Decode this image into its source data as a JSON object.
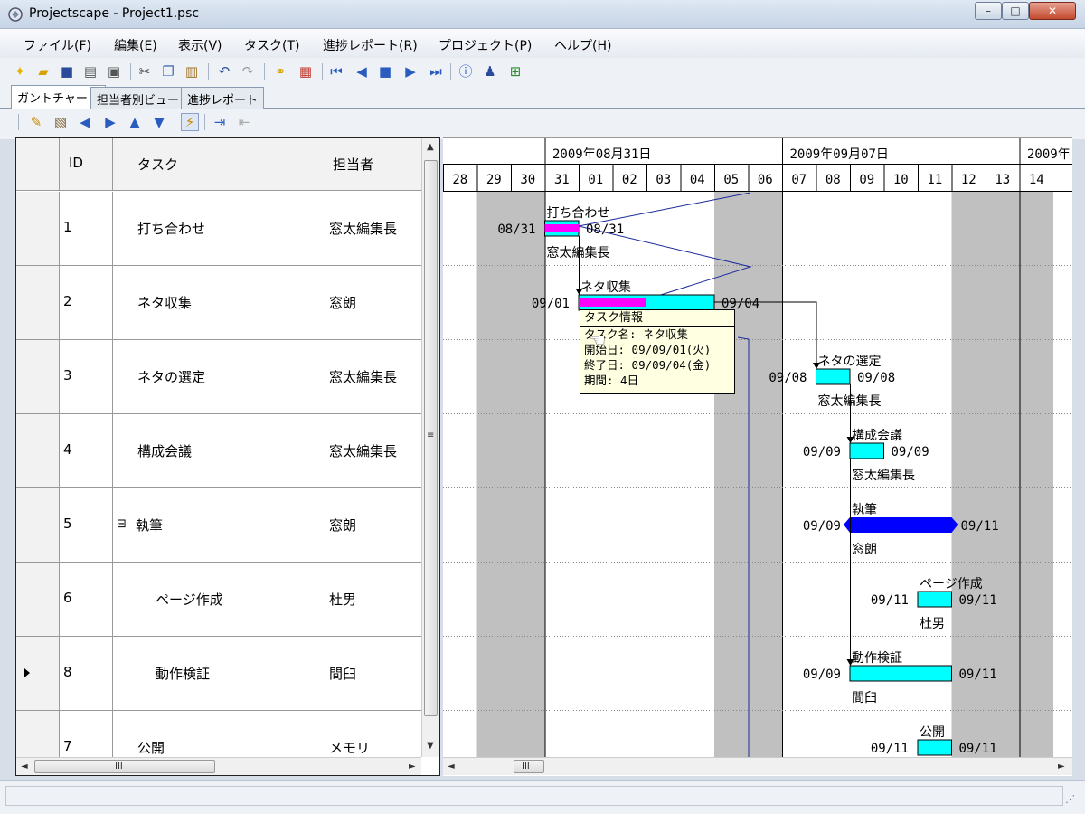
{
  "window": {
    "title": "Projectscape - Project1.psc",
    "controls": {
      "minimize": "–",
      "maximize": "□",
      "close": "✕"
    }
  },
  "menu": [
    "ファイル(F)",
    "編集(E)",
    "表示(V)",
    "タスク(T)",
    "進捗レポート(R)",
    "プロジェクト(P)",
    "ヘルプ(H)"
  ],
  "toolbar_icons": [
    "new-file-icon",
    "open-folder-icon",
    "save-icon",
    "print-icon",
    "print-preview-icon",
    "cut-icon",
    "copy-icon",
    "paste-icon",
    "undo-icon",
    "redo-icon",
    "link-icon",
    "calendar-icon",
    "first-icon",
    "prev-icon",
    "stop-icon",
    "next-icon",
    "last-icon",
    "info-icon",
    "users-icon",
    "add-task-icon"
  ],
  "tabs": [
    "ガントチャート",
    "担当者別ビュー",
    "進捗レポート"
  ],
  "grid": {
    "headers": {
      "id": "ID",
      "task": "タスク",
      "assignee": "担当者"
    },
    "rows": [
      {
        "id": "1",
        "task": "打ち合わせ",
        "assignee": "窓太編集長",
        "indent": 0,
        "collapse": "",
        "current": false
      },
      {
        "id": "2",
        "task": "ネタ収集",
        "assignee": "窓朗",
        "indent": 0,
        "collapse": "",
        "current": false
      },
      {
        "id": "3",
        "task": "ネタの選定",
        "assignee": "窓太編集長",
        "indent": 0,
        "collapse": "",
        "current": false
      },
      {
        "id": "4",
        "task": "構成会議",
        "assignee": "窓太編集長",
        "indent": 0,
        "collapse": "",
        "current": false
      },
      {
        "id": "5",
        "task": "執筆",
        "assignee": "窓朗",
        "indent": 0,
        "collapse": "⊟",
        "current": false
      },
      {
        "id": "6",
        "task": "ページ作成",
        "assignee": "杜男",
        "indent": 1,
        "collapse": "",
        "current": false
      },
      {
        "id": "8",
        "task": "動作検証",
        "assignee": "間臼",
        "indent": 1,
        "collapse": "",
        "current": true
      },
      {
        "id": "7",
        "task": "公開",
        "assignee": "メモリ",
        "indent": 0,
        "collapse": "",
        "current": false
      }
    ],
    "scroll_marks": {
      "left": "◄",
      "right": "►",
      "up": "▲",
      "down": "▼",
      "grip": "III",
      "vgrip": "≡"
    }
  },
  "gantt": {
    "weeks": [
      "2009年08月31日",
      "2009年09月07日",
      "2009年"
    ],
    "days": [
      "28",
      "29",
      "30",
      "31",
      "01",
      "02",
      "03",
      "04",
      "05",
      "06",
      "07",
      "08",
      "09",
      "10",
      "11",
      "12",
      "13",
      "14"
    ],
    "weekend_days": [
      "29",
      "30",
      "05",
      "06",
      "12",
      "13",
      "14"
    ],
    "tasks": [
      {
        "name": "打ち合わせ",
        "start": "08/31",
        "end": "08/31",
        "assignee": "窓太編集長",
        "progress": 1.0,
        "type": "task"
      },
      {
        "name": "ネタ収集",
        "start": "09/01",
        "end": "09/04",
        "assignee": "",
        "progress": 0.5,
        "type": "task"
      },
      {
        "name": "ネタの選定",
        "start": "09/08",
        "end": "09/08",
        "assignee": "窓太編集長",
        "progress": 0,
        "type": "task"
      },
      {
        "name": "構成会議",
        "start": "09/09",
        "end": "09/09",
        "assignee": "窓太編集長",
        "progress": 0,
        "type": "task"
      },
      {
        "name": "執筆",
        "start": "09/09",
        "end": "09/11",
        "assignee": "窓朗",
        "progress": 0,
        "type": "summary"
      },
      {
        "name": "ページ作成",
        "start": "09/11",
        "end": "09/11",
        "assignee": "杜男",
        "progress": 0,
        "type": "task"
      },
      {
        "name": "動作検証",
        "start": "09/09",
        "end": "09/11",
        "assignee": "間臼",
        "progress": 0,
        "type": "task"
      },
      {
        "name": "公開",
        "start": "09/11",
        "end": "09/11",
        "assignee": "",
        "progress": 0,
        "type": "task"
      }
    ],
    "colors": {
      "bar": "#00ffff",
      "progress": "#ff00ff",
      "summary": "#0000ff",
      "weekend": "#c0c0c0"
    }
  },
  "tooltip": {
    "title": "タスク情報",
    "lines": [
      "タスク名: ネタ収集",
      "開始日: 09/09/01(火)",
      "終了日: 09/09/04(金)",
      "期間: 4日"
    ]
  }
}
